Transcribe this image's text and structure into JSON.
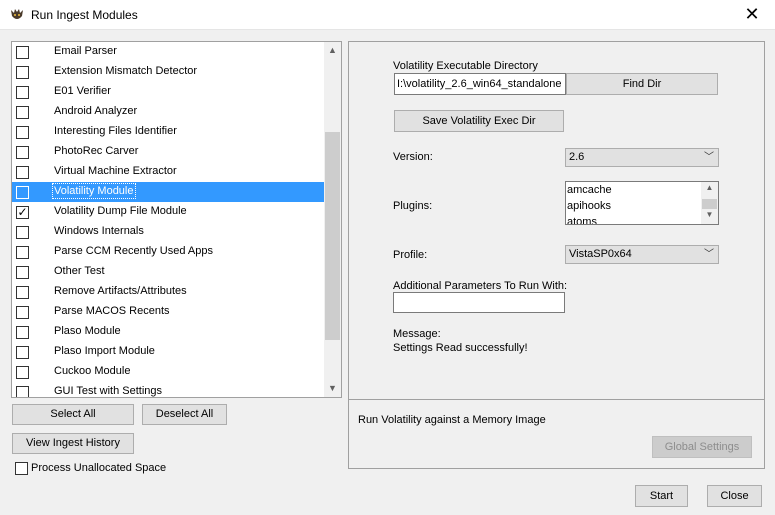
{
  "window": {
    "title": "Run Ingest Modules",
    "close_glyph": "✕",
    "app_icon": "autopsy-dog-icon"
  },
  "modules": [
    {
      "label": "Email Parser",
      "checked": false,
      "selected": false
    },
    {
      "label": "Extension Mismatch Detector",
      "checked": false,
      "selected": false
    },
    {
      "label": "E01 Verifier",
      "checked": false,
      "selected": false
    },
    {
      "label": "Android Analyzer",
      "checked": false,
      "selected": false
    },
    {
      "label": "Interesting Files Identifier",
      "checked": false,
      "selected": false
    },
    {
      "label": "PhotoRec Carver",
      "checked": false,
      "selected": false
    },
    {
      "label": "Virtual Machine Extractor",
      "checked": false,
      "selected": false
    },
    {
      "label": "Volatility Module",
      "checked": false,
      "selected": true
    },
    {
      "label": "Volatility Dump File Module",
      "checked": true,
      "selected": false
    },
    {
      "label": "Windows Internals",
      "checked": false,
      "selected": false
    },
    {
      "label": "Parse CCM Recently Used Apps",
      "checked": false,
      "selected": false
    },
    {
      "label": "Other Test",
      "checked": false,
      "selected": false
    },
    {
      "label": "Remove Artifacts/Attributes",
      "checked": false,
      "selected": false
    },
    {
      "label": "Parse MACOS Recents",
      "checked": false,
      "selected": false
    },
    {
      "label": "Plaso Module",
      "checked": false,
      "selected": false
    },
    {
      "label": "Plaso Import Module",
      "checked": false,
      "selected": false
    },
    {
      "label": "Cuckoo Module",
      "checked": false,
      "selected": false
    },
    {
      "label": "GUI Test with Settings",
      "checked": false,
      "selected": false
    }
  ],
  "left_buttons": {
    "select_all": "Select All",
    "deselect_all": "Deselect All",
    "view_history": "View Ingest History"
  },
  "process_unallocated": {
    "label": "Process Unallocated Space",
    "checked": false
  },
  "settings": {
    "exec_dir_label": "Volatility Executable Directory",
    "exec_dir_value": "I:\\volatility_2.6_win64_standalone",
    "find_dir_button": "Find Dir",
    "save_button": "Save Volatility Exec Dir",
    "version_label": "Version:",
    "version_value": "2.6",
    "plugins_label": "Plugins:",
    "plugins": [
      "amcache",
      "apihooks",
      "atoms"
    ],
    "profile_label": "Profile:",
    "profile_value": "VistaSP0x64",
    "additional_params_label": "Additional Parameters To Run With:",
    "additional_params_value": "",
    "message_label": "Message:",
    "message_text": "Settings Read successfully!"
  },
  "description": {
    "text": "Run Volatility against a Memory Image",
    "global_settings_button": "Global Settings"
  },
  "bottom_buttons": {
    "start": "Start",
    "close": "Close"
  }
}
